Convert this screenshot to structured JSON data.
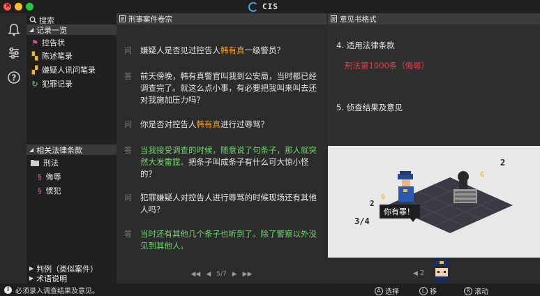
{
  "window": {
    "title": "CIS"
  },
  "sidebar": {
    "search_label": "搜索",
    "records_title": "记录一览",
    "records": [
      {
        "label": "控告状",
        "icon": "complaint-icon"
      },
      {
        "label": "陈述笔录",
        "icon": "statement-icon"
      },
      {
        "label": "嫌疑人讯问笔录",
        "icon": "interrogation-icon"
      },
      {
        "label": "犯罪记录",
        "icon": "criminal-record-icon"
      }
    ],
    "law_title": "相关法律条款",
    "law_folder": "刑法",
    "law_items": [
      "侮辱",
      "惯犯"
    ],
    "cases_title": "判例（类似案件）",
    "glossary_title": "术语说明"
  },
  "middle": {
    "header": "刑事案件卷宗",
    "q_tag": "问",
    "a_tag": "答",
    "pager": "5/7"
  },
  "right": {
    "header": "意见书格式",
    "section4_title": "4. 适用法律条款",
    "law_applied": "刑法第1000条（侮辱）",
    "section5_title": "5. 侦查结果及意见",
    "speech": "你有罪！",
    "pager": "2"
  },
  "status": {
    "message": "必须录入调查结果及意见。",
    "hint_select": "选择",
    "hint_move": "移",
    "hint_scroll": "滚动"
  },
  "colors": {
    "highlight_name": "#f0a02e",
    "answer_green": "#6fd56f",
    "law_red": "#e0404a"
  }
}
